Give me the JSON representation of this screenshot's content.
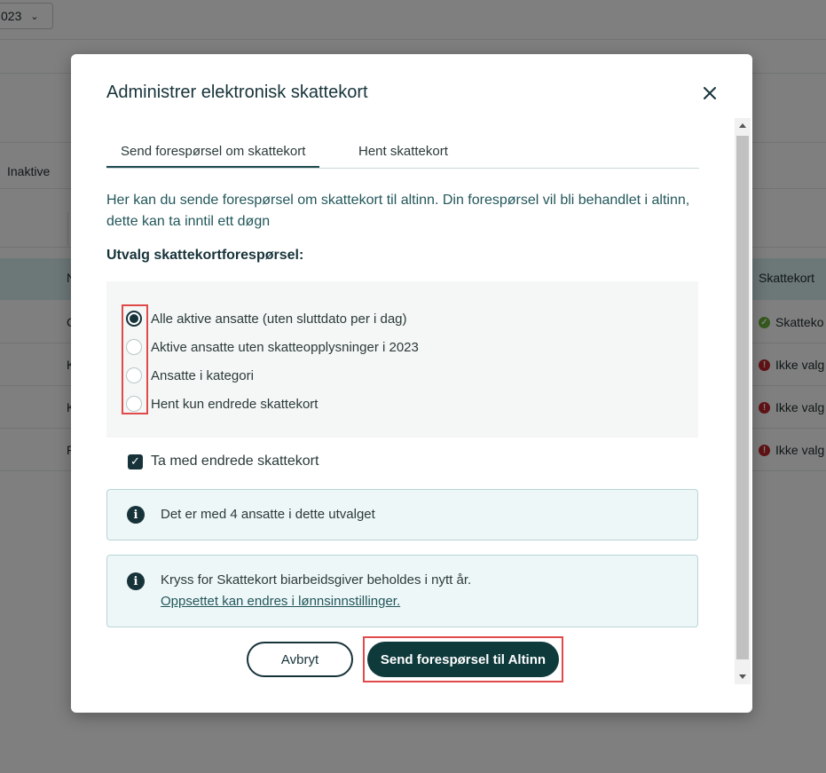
{
  "background": {
    "year_select": "023",
    "tab_inaktive": "Inaktive",
    "table_header_n": "N",
    "table_header_skattekort": "Skattekort",
    "rows": [
      {
        "letter": "C",
        "status": "Skatteko",
        "status_type": "ok"
      },
      {
        "letter": "K",
        "status": "Ikke valg",
        "status_type": "error"
      },
      {
        "letter": "K",
        "status": "Ikke valg",
        "status_type": "error"
      },
      {
        "letter": "F",
        "status": "Ikke valg",
        "status_type": "error"
      }
    ]
  },
  "modal": {
    "title": "Administrer elektronisk skattekort",
    "close_icon": "close-icon",
    "tabs": [
      {
        "label": "Send forespørsel om skattekort",
        "active": true
      },
      {
        "label": "Hent skattekort",
        "active": false
      }
    ],
    "intro": "Her kan du sende forespørsel om skattekort til altinn. Din forespørsel vil bli behandlet i altinn, dette kan ta inntil ett døgn",
    "section_label": "Utvalg skattekortforespørsel:",
    "options": [
      {
        "label": "Alle aktive ansatte (uten sluttdato per i dag)",
        "checked": true
      },
      {
        "label": "Aktive ansatte uten skatteopplysninger i 2023",
        "checked": false
      },
      {
        "label": "Ansatte i kategori",
        "checked": false
      },
      {
        "label": "Hent kun endrede skattekort",
        "checked": false
      }
    ],
    "checkbox": {
      "label": "Ta med endrede skattekort",
      "checked": true
    },
    "info_1": "Det er med 4 ansatte i dette utvalget",
    "info_2_text": "Kryss for Skattekort biarbeidsgiver beholdes i nytt år.",
    "info_2_link": "Oppsettet kan endres i lønnsinnstillinger.",
    "cancel_label": "Avbryt",
    "send_label": "Send forespørsel til Altinn"
  },
  "colors": {
    "primary": "#0f3a3c",
    "highlight": "#e04a4a",
    "info_bg": "#eef7f8",
    "ok": "#6ab23c",
    "error": "#c0272d"
  }
}
